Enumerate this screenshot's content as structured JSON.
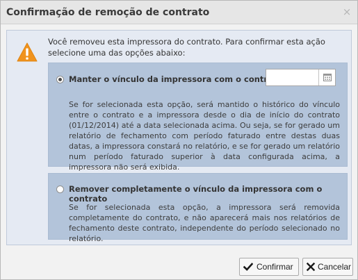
{
  "dialog": {
    "title": "Confirmação de remoção de contrato",
    "close_icon": "×"
  },
  "intro_text": "Você removeu esta impressora do contrato. Para confirmar esta ação selecione uma das opções abaixo:",
  "options": [
    {
      "label": "Manter o vínculo da impressora com o contrato até:",
      "selected": true,
      "date_value": "",
      "description": "Se for selecionada esta opção, será mantido o histórico do vínculo entre o contrato e a impressora desde o dia de início do contrato (01/12/2014) até a data selecionada acima. Ou seja, se for gerado um relatório de fechamento com período faturado entre destas duas datas, a impressora constará no relatório, e se for gerado um relatório num período faturado superior à data configurada acima, a impressora não será exibida."
    },
    {
      "label": "Remover completamente o vínculo da impressora com o contrato",
      "selected": false,
      "description": "Se for selecionada esta opção, a impressora será removida completamente do contrato, e não aparecerá mais nos relatórios de fechamento deste contrato, independente do período selecionado no relatório."
    }
  ],
  "buttons": {
    "confirm": "Confirmar",
    "cancel": "Cancelar"
  },
  "colors": {
    "warning": "#f0931e",
    "confirm_check": "#1a1a1a",
    "cancel_x": "#1a1a1a",
    "option_bg": "#b3c4da",
    "panel_bg": "#e5eaf3"
  },
  "icons": {
    "warning": "warning-triangle-icon",
    "calendar": "calendar-icon",
    "confirm": "check-icon",
    "cancel": "x-icon"
  }
}
